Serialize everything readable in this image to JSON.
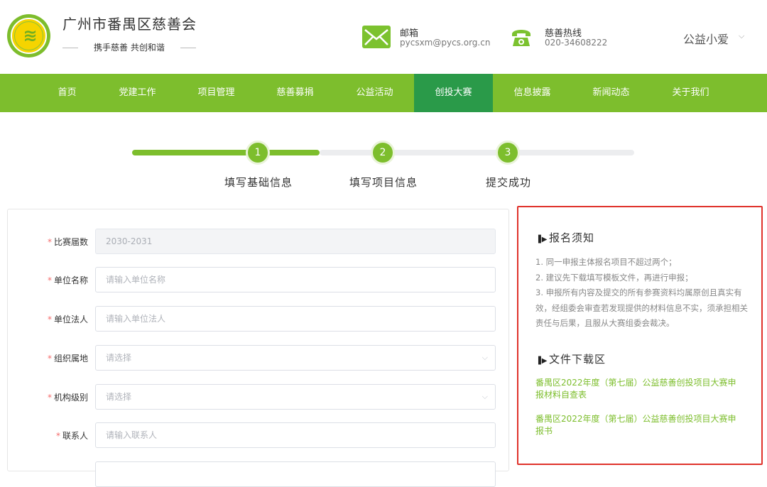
{
  "header": {
    "org_name": "广州市番禺区慈善会",
    "slogan": "携手慈善 共创和谐",
    "email_title": "邮箱",
    "email_value": "pycsxm@pycs.org.cn",
    "hotline_title": "慈善热线",
    "hotline_value": "020-34608222",
    "user_name": "公益小爱",
    "user_chevron": "⌵"
  },
  "nav": {
    "items": [
      "首页",
      "党建工作",
      "项目管理",
      "慈善募捐",
      "公益活动",
      "创投大赛",
      "信息披露",
      "新闻动态",
      "关于我们"
    ],
    "active_index": 5
  },
  "steps": [
    {
      "number": "1",
      "label": "填写基础信息"
    },
    {
      "number": "2",
      "label": "填写项目信息"
    },
    {
      "number": "3",
      "label": "提交成功"
    }
  ],
  "form": {
    "fields": [
      {
        "label": "比赛届数",
        "value": "2030-2031",
        "type": "disabled"
      },
      {
        "label": "单位名称",
        "placeholder": "请输入单位名称",
        "type": "text"
      },
      {
        "label": "单位法人",
        "placeholder": "请输入单位法人",
        "type": "text"
      },
      {
        "label": "组织属地",
        "placeholder": "请选择",
        "type": "select"
      },
      {
        "label": "机构级别",
        "placeholder": "请选择",
        "type": "select"
      },
      {
        "label": "联系人",
        "placeholder": "请输入联系人",
        "type": "text"
      }
    ]
  },
  "notice": {
    "heading": "报名须知",
    "lines": [
      "1. 同一申报主体报名项目不超过两个；",
      "2. 建议先下载填写模板文件，再进行申报；",
      "3. 申报所有内容及提交的所有参赛资料均属原创且真实有效，经组委会审查若发现提供的材料信息不实，须承担相关责任与后果，且服从大赛组委会裁决。"
    ],
    "download_heading": "文件下载区",
    "downloads": [
      "番禺区2022年度（第七届）公益慈善创投项目大赛申报材料自查表",
      "番禺区2022年度（第七届）公益慈善创投项目大赛申报书"
    ]
  },
  "colors": {
    "brand_green": "#7dbe2d",
    "active_nav": "#2a9a49",
    "highlight_border": "#e0322b"
  }
}
